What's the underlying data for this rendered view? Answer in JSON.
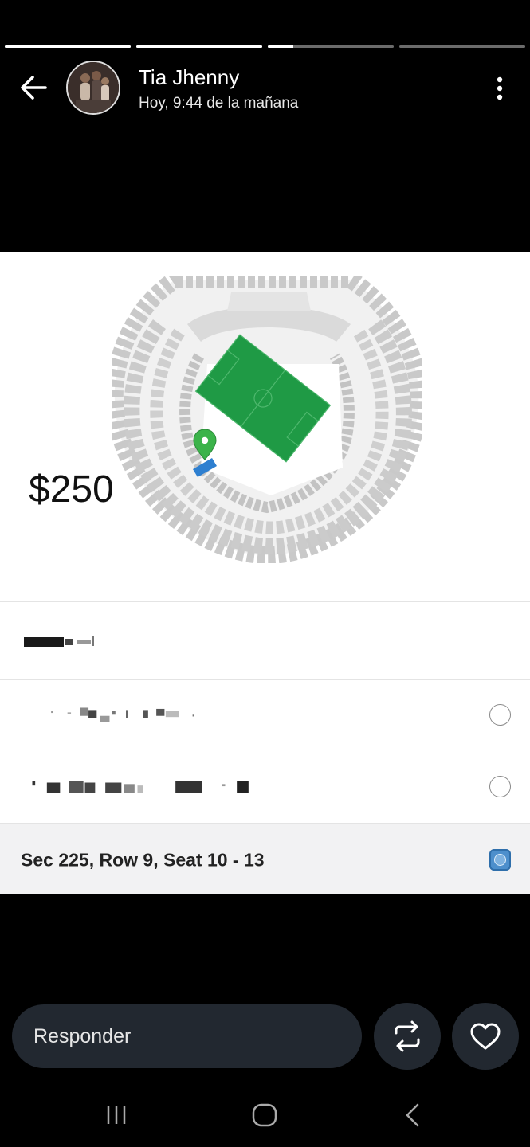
{
  "story": {
    "progress": [
      1,
      1,
      0.2,
      0
    ]
  },
  "header": {
    "user_name": "Tia Jhenny",
    "timestamp": "Hoy, 9:44 de la mañana",
    "back_icon": "back-arrow-icon",
    "more_icon": "more-vertical-icon"
  },
  "card": {
    "price": "$250",
    "selected_seat": "Sec 225, Row 9, Seat 10 - 13",
    "map_pin_color": "#3bb34a",
    "field_color": "#1f9a45",
    "selected_section_color": "#2e7fd0"
  },
  "footer": {
    "reply_placeholder": "Responder",
    "repost_icon": "repost-icon",
    "like_icon": "heart-icon"
  },
  "navbar": {
    "recent_icon": "recent-apps-icon",
    "home_icon": "home-icon",
    "back_icon": "nav-back-icon"
  }
}
